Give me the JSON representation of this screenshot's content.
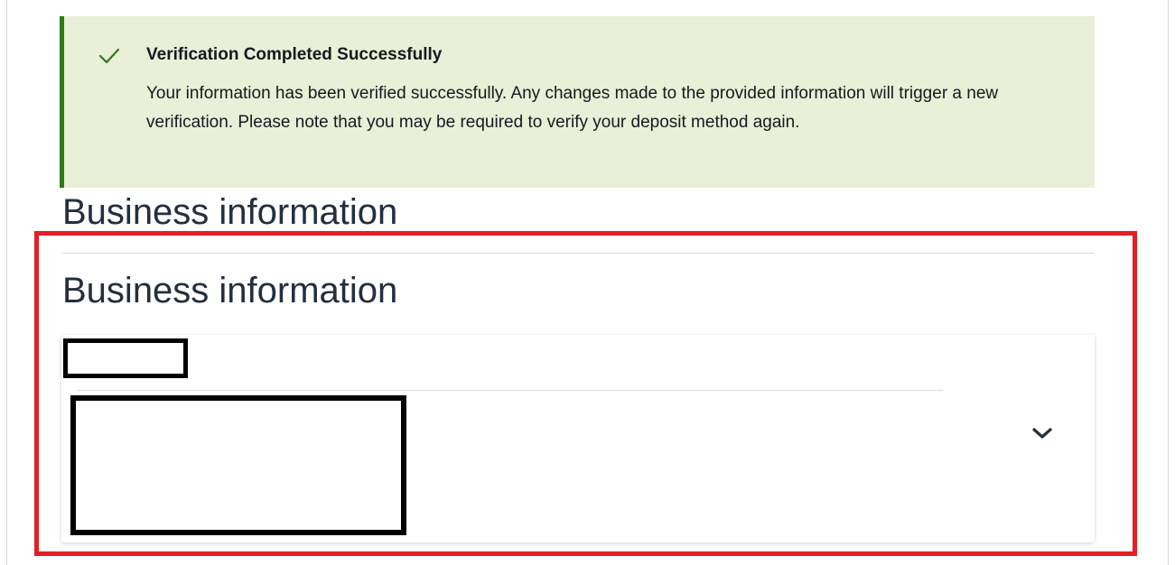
{
  "alert": {
    "icon": "check-icon",
    "title": "Verification Completed Successfully",
    "body": "Your information has been verified successfully. Any changes made to the provided information will trigger a new verification. Please note that you may be required to verify your deposit method again.",
    "status_color": "#2d7a19",
    "background_color": "#eaefd8"
  },
  "section": {
    "title": "Business information"
  },
  "panel": {
    "title": "Business information",
    "field_label": "",
    "field_value": "",
    "expand_icon": "chevron-down-icon"
  },
  "annotation": {
    "highlight_color": "#e31e24"
  }
}
